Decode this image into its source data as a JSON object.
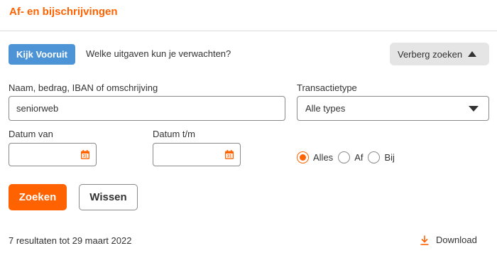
{
  "header": {
    "title": "Af- en bijschrijvingen"
  },
  "top_row": {
    "kijk_vooruit_label": "Kijk Vooruit",
    "kijk_vooruit_text": "Welke uitgaven kun je verwachten?",
    "verberg_label": "Verberg zoeken"
  },
  "search": {
    "label": "Naam, bedrag, IBAN of omschrijving",
    "value": "seniorweb"
  },
  "transaction_type": {
    "label": "Transactietype",
    "selected": "Alle types"
  },
  "date_from": {
    "label": "Datum van",
    "value": ""
  },
  "date_to": {
    "label": "Datum t/m",
    "value": ""
  },
  "calendar_icon_text": "31",
  "radio": {
    "options": [
      "Alles",
      "Af",
      "Bij"
    ],
    "selected": "Alles"
  },
  "buttons": {
    "search_label": "Zoeken",
    "clear_label": "Wissen"
  },
  "results": {
    "summary": "7 resultaten tot 29 maart 2022",
    "download_label": "Download"
  },
  "colors": {
    "accent": "#ff6200",
    "info_blue": "#4d94d6",
    "gray_button": "#e5e5e5"
  },
  "icons": {
    "verberg": "triangle-up-icon",
    "select": "triangle-down-icon",
    "date": "calendar-icon",
    "download": "download-icon"
  }
}
